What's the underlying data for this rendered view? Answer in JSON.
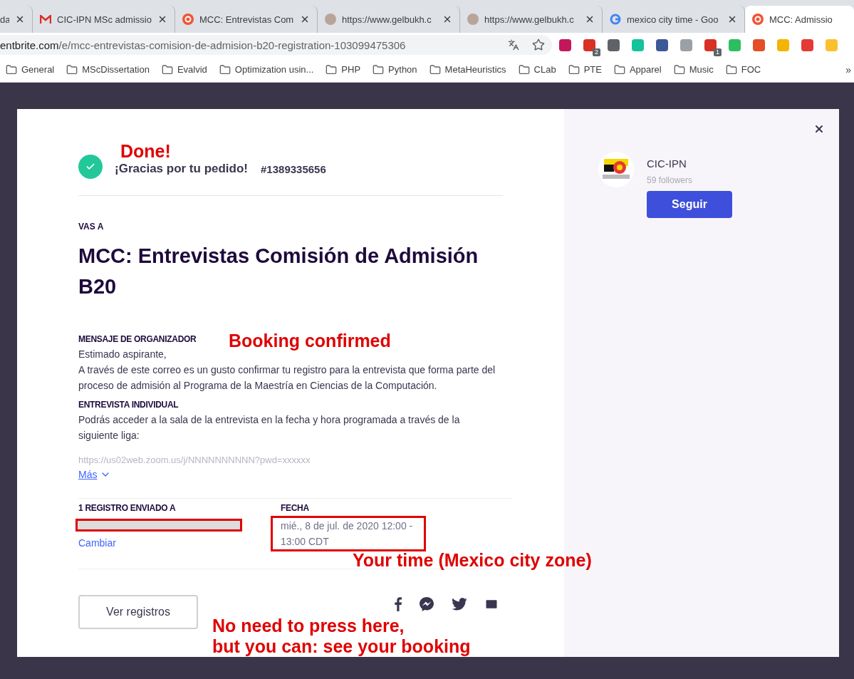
{
  "browser": {
    "tabs": [
      {
        "title": "da",
        "kind": "plain",
        "selected": false,
        "closable": true
      },
      {
        "title": "CIC-IPN MSc admissio",
        "kind": "mail",
        "selected": false,
        "closable": true
      },
      {
        "title": "MCC: Entrevistas Com",
        "kind": "event",
        "selected": false,
        "closable": true
      },
      {
        "title": "https://www.gelbukh.c",
        "kind": "person",
        "selected": false,
        "closable": true
      },
      {
        "title": "https://www.gelbukh.c",
        "kind": "person",
        "selected": false,
        "closable": true
      },
      {
        "title": "mexico city time - Goo",
        "kind": "search",
        "selected": false,
        "closable": true
      },
      {
        "title": "MCC: Admissio",
        "kind": "event",
        "selected": true,
        "closable": false
      }
    ],
    "address": {
      "host": "entbrite.com",
      "path": "/e/mcc-entrevistas-comision-de-admision-b20-registration-103099475306"
    },
    "extensions": [
      {
        "color": "#c2185b"
      },
      {
        "color": "#d93025",
        "badge": "2"
      },
      {
        "color": "#5f6368"
      },
      {
        "color": "#15c39a"
      },
      {
        "color": "#3b5998"
      },
      {
        "color": "#9aa0a6"
      },
      {
        "color": "#d93025",
        "badge": "1"
      },
      {
        "color": "#2dbe60"
      },
      {
        "color": "#e44d26"
      },
      {
        "color": "#f4b400"
      },
      {
        "color": "#e53935"
      },
      {
        "color": "#fbc02d"
      }
    ],
    "bookmarks": [
      "General",
      "MScDissertation",
      "Evalvid",
      "Optimization usin...",
      "PHP",
      "Python",
      "MetaHeuristics",
      "CLab",
      "PTE",
      "Apparel",
      "Music",
      "FOC"
    ],
    "bookmarks_more": "»"
  },
  "modal": {
    "order": {
      "message": "¡Gracias por tu pedido!",
      "number": "#1389335656"
    },
    "eyebrow": "VAS A",
    "event_title": "MCC: Entrevistas Comisión de Admisión B20",
    "blocks": [
      {
        "kind": "heading",
        "text": "MENSAJE DE ORGANIZADOR"
      },
      {
        "kind": "text",
        "text": "Estimado aspirante,"
      },
      {
        "kind": "text",
        "text": "A través de este correo es un gusto confirmar tu registro para la entrevista que forma parte del proceso de admisión al Programa de la Maestría en Ciencias de la Computación."
      },
      {
        "kind": "heading",
        "text": "ENTREVISTA INDIVIDUAL"
      },
      {
        "kind": "text",
        "text": "Podrás acceder a la sala de la entrevista en la fecha y hora programada a través de la siguiente liga:"
      },
      {
        "kind": "faded",
        "text": "https://us02web.zoom.us/j/NNNNNNNNNN?pwd=xxxxxx"
      }
    ],
    "more_link": "Más",
    "recipient": {
      "label": "1 REGISTRO ENVIADO A",
      "redacted": true,
      "highlighted": true,
      "change_link": "Cambiar"
    },
    "date": {
      "label": "FECHA",
      "value": "mié., 8 de jul. de 2020 12:00 - 13:00 CDT",
      "highlighted": true
    },
    "view_button": "Ver registros",
    "organizer": {
      "name": "CIC-IPN",
      "followers": "59 followers",
      "follow_button": "Seguir"
    }
  },
  "annotations": [
    {
      "text": "Done!"
    },
    {
      "text": "Booking confirmed"
    },
    {
      "text": "Your time (Mexico city zone)"
    },
    {
      "text": "No need to press here,"
    },
    {
      "text": "but you can: see your booking"
    }
  ]
}
